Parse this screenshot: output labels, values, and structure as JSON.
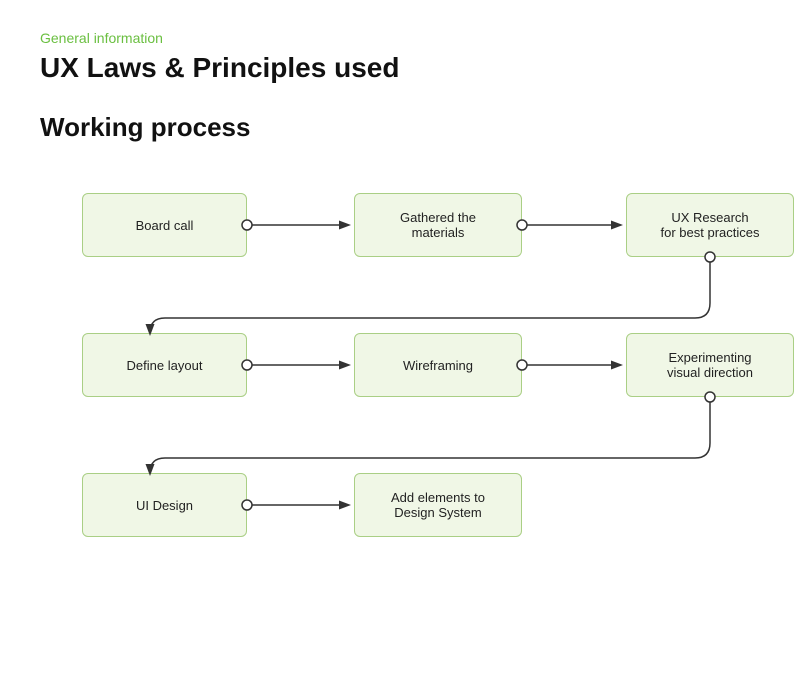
{
  "header": {
    "category": "General information",
    "title": "UX Laws & Principles used"
  },
  "section": {
    "title": "Working process"
  },
  "nodes": [
    {
      "id": "board-call",
      "label": "Board call",
      "row": 0,
      "col": 0
    },
    {
      "id": "gathered-materials",
      "label": "Gathered the\nmaterials",
      "row": 0,
      "col": 1
    },
    {
      "id": "ux-research",
      "label": "UX Research\nfor best practices",
      "row": 0,
      "col": 2
    },
    {
      "id": "define-layout",
      "label": "Define layout",
      "row": 1,
      "col": 0
    },
    {
      "id": "wireframing",
      "label": "Wireframing",
      "row": 1,
      "col": 1
    },
    {
      "id": "experimenting",
      "label": "Experimenting\nvisual direction",
      "row": 1,
      "col": 2
    },
    {
      "id": "ui-design",
      "label": "UI Design",
      "row": 2,
      "col": 0
    },
    {
      "id": "add-elements",
      "label": "Add elements to\nDesign System",
      "row": 2,
      "col": 1
    }
  ]
}
